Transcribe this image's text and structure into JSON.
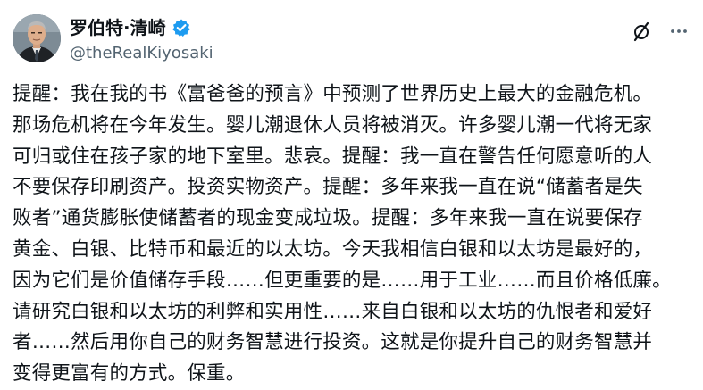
{
  "author": {
    "display_name": "罗伯特·清崎",
    "handle": "@theRealKiyosaki",
    "verified_color": "#1d9bf0"
  },
  "actions": {
    "grok_icon": "grok-slash-icon",
    "more_icon": "more-dots-icon"
  },
  "post": {
    "text": "提醒：我在我的书《富爸爸的预言》中预测了世界历史上最大的金融危机。\n那场危机将在今年发生。婴儿潮退休人员将被消灭。许多婴儿潮一代将无家\n可归或住在孩子家的地下室里。悲哀。提醒：我一直在警告任何愿意听的人\n不要保存印刷资产。投资实物资产。提醒：多年来我一直在说“储蓄者是失\n败者”通货膨胀使储蓄者的现金变成垃圾。提醒：多年来我一直在说要保存\n黄金、白银、比特币和最近的以太坊。今天我相信白银和以太坊是最好的，\n因为它们是价值储存手段……但更重要的是……用于工业……而且价格低廉。\n请研究白银和以太坊的利弊和实用性……来自白银和以太坊的仇恨者和爱好\n者……然后用你自己的财务智慧进行投资。这就是你提升自己的财务智慧并\n变得更富有的方式。保重。"
  },
  "colors": {
    "text_primary": "#0f1419",
    "text_secondary": "#536471",
    "accent": "#1d9bf0"
  }
}
